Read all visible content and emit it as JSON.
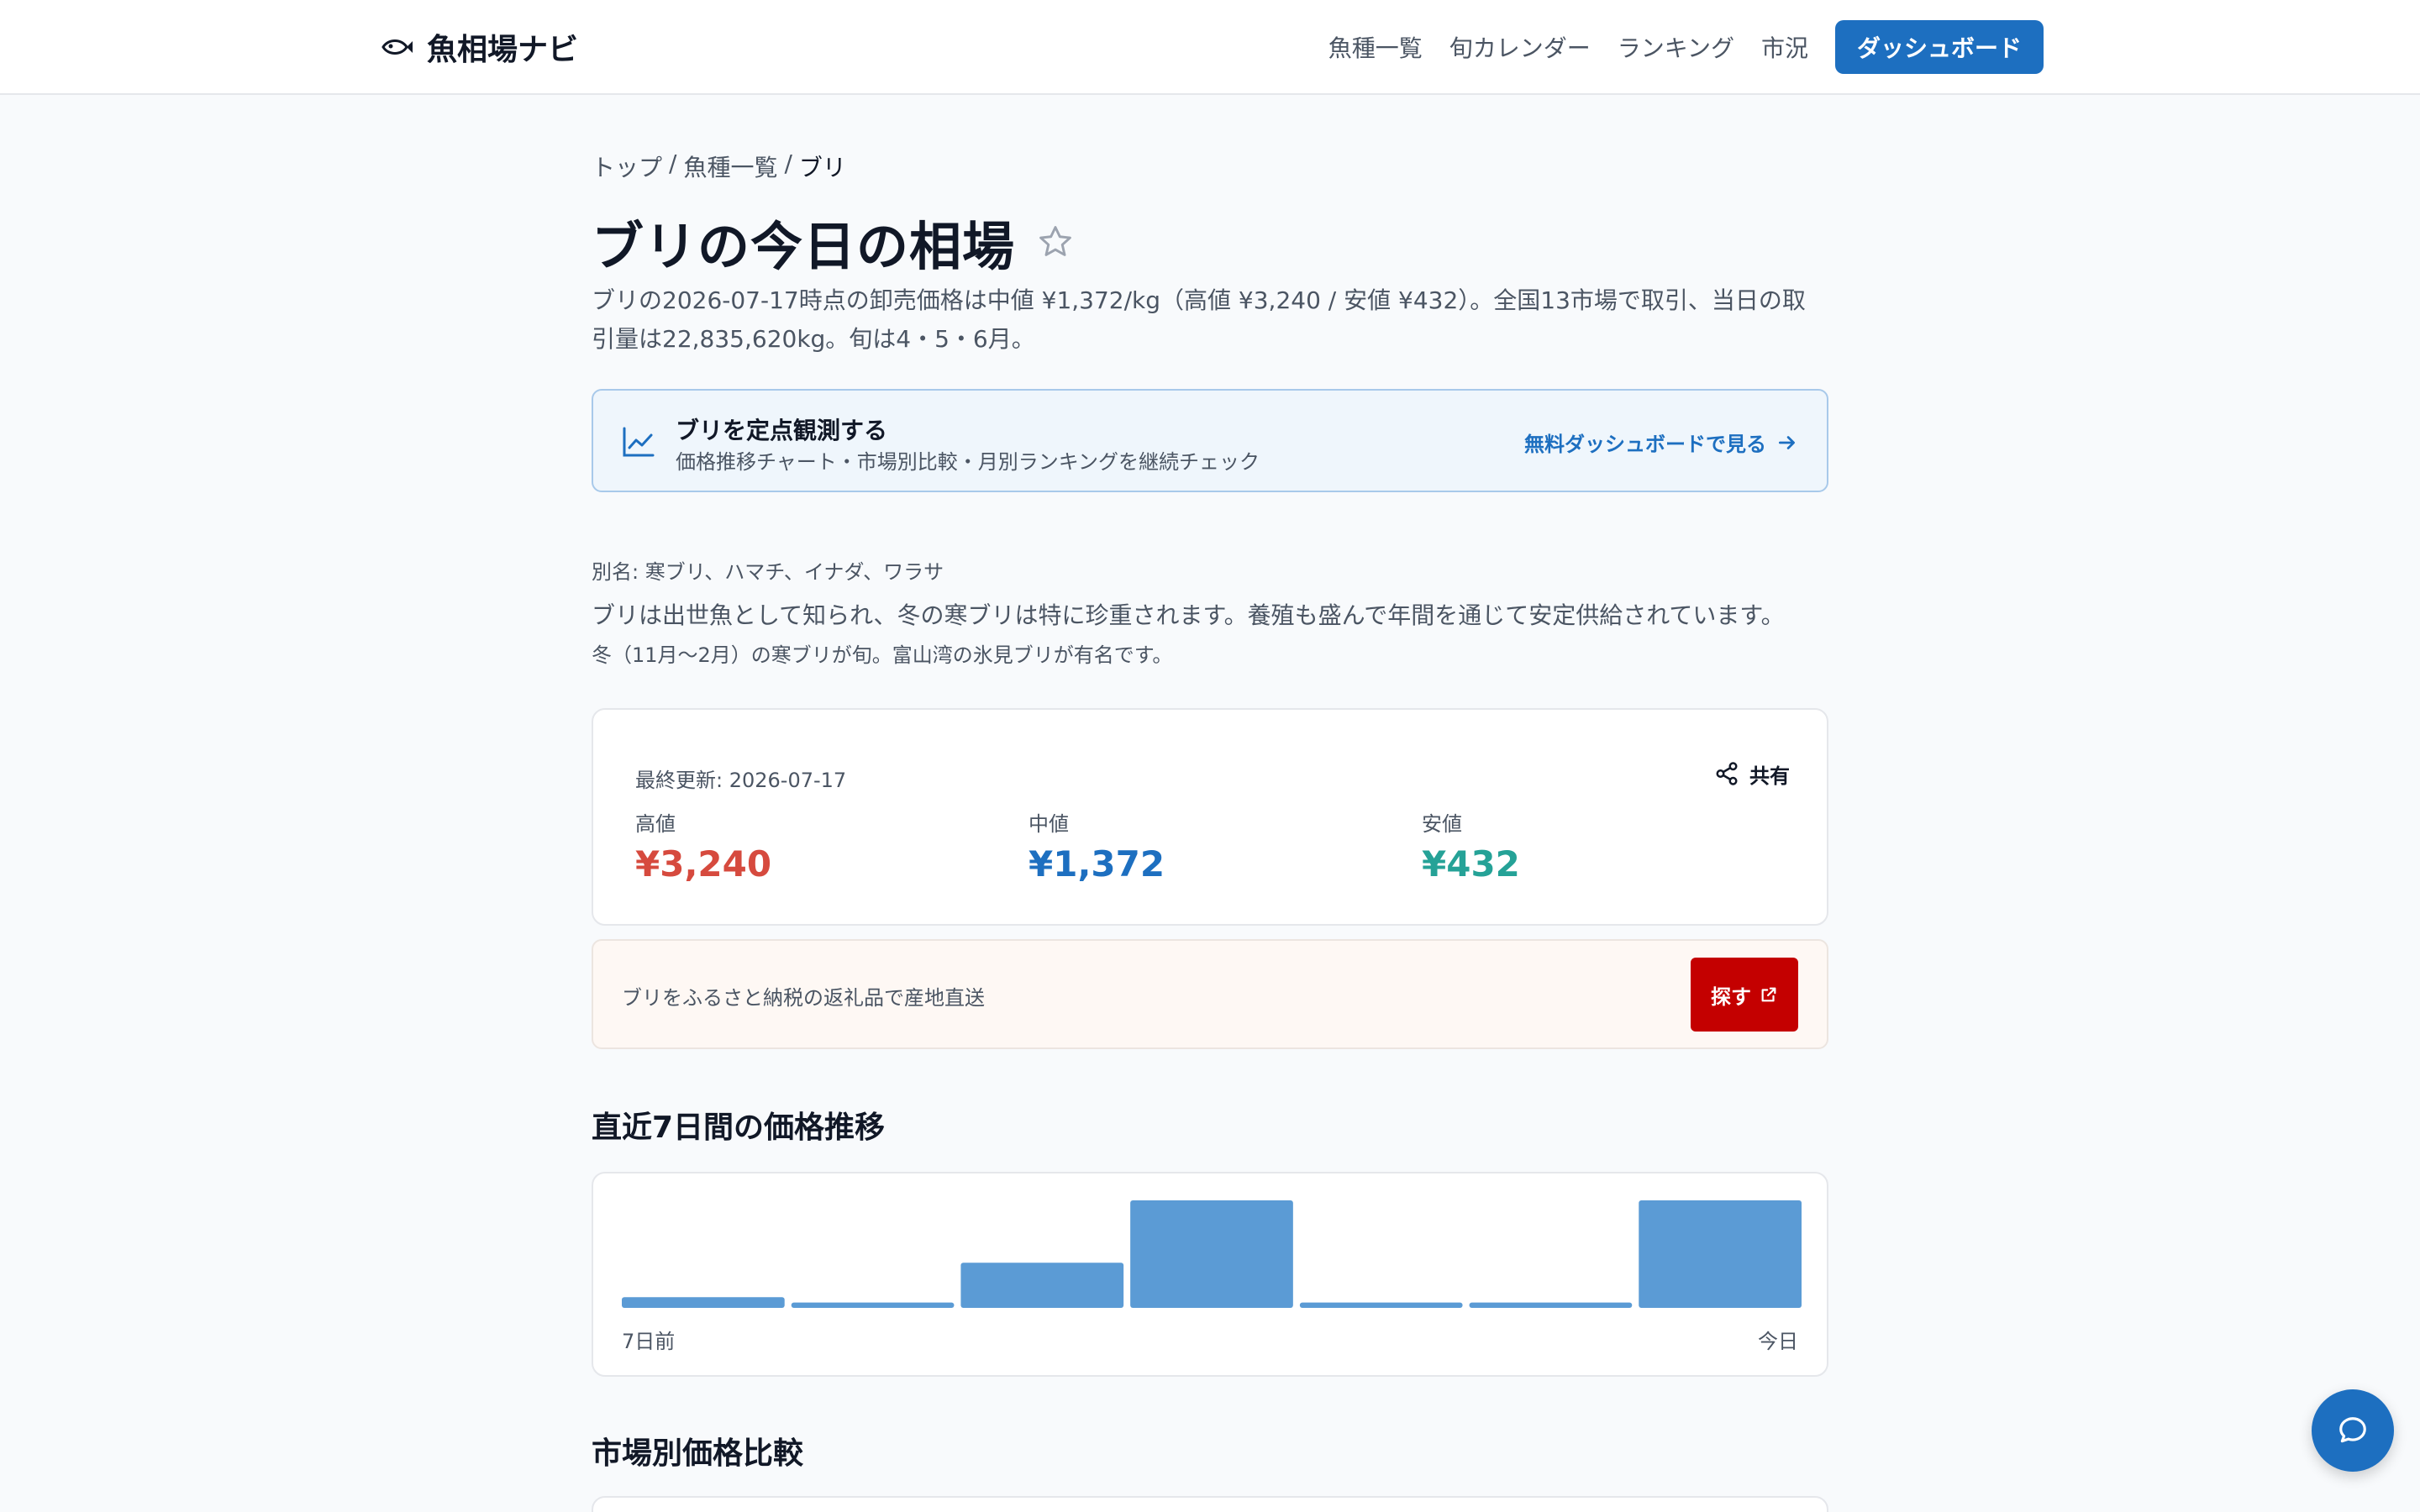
{
  "header": {
    "brand": "魚相場ナビ",
    "nav": [
      "魚種一覧",
      "旬カレンダー",
      "ランキング",
      "市況"
    ],
    "cta": "ダッシュボード"
  },
  "breadcrumb": {
    "home": "トップ",
    "list": "魚種一覧",
    "current": "ブリ",
    "separator": "/"
  },
  "page": {
    "title": "ブリの今日の相場",
    "summary": "ブリの2026-07-17時点の卸売価格は中値 ¥1,372/kg（高値 ¥3,240 / 安値 ¥432）。全国13市場で取引、当日の取引量は22,835,620kg。旬は4・5・6月。"
  },
  "promo": {
    "title": "ブリを定点観測する",
    "subtitle": "価格推移チャート・市場別比較・月別ランキングを継続チェック",
    "link": "無料ダッシュボードで見る"
  },
  "description": {
    "aliases": "別名: 寒ブリ、ハマチ、イナダ、ワラサ",
    "body": "ブリは出世魚として知られ、冬の寒ブリは特に珍重されます。養殖も盛んで年間を通じて安定供給されています。",
    "note": "冬（11月〜2月）の寒ブリが旬。富山湾の氷見ブリが有名です。"
  },
  "prices": {
    "updated": "最終更新: 2026-07-17",
    "share": "共有",
    "high_label": "高値",
    "high": "¥3,240",
    "mid_label": "中値",
    "mid": "¥1,372",
    "low_label": "安値",
    "low": "¥432"
  },
  "furusato": {
    "text": "ブリをふるさと納税の返礼品で産地直送",
    "button": "探す"
  },
  "sections": {
    "trend": "直近7日間の価格推移",
    "market": "市場別価格比較"
  },
  "chart_data": {
    "type": "bar",
    "categories": [
      "7日前",
      "",
      "",
      "",
      "",
      "",
      "今日"
    ],
    "values": [
      0.1,
      0.05,
      0.42,
      1.0,
      0.05,
      0.05,
      1.0
    ],
    "xlabel_start": "7日前",
    "xlabel_end": "今日",
    "color": "#5b9bd5"
  },
  "colors": {
    "accent": "#1d6fc0",
    "high": "#d64a3e",
    "low": "#25a297",
    "furusato": "#c40000"
  }
}
